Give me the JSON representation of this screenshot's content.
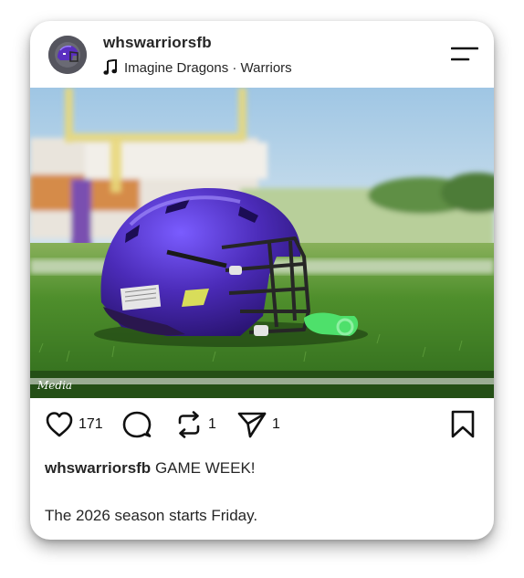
{
  "post": {
    "username": "whswarriorsfb",
    "avatar_icon": "helmet-avatar",
    "music": {
      "icon": "music-note-icon",
      "text": "Imagine Dragons · Warriors"
    },
    "menu_icon": "menu-icon",
    "image_description_icon": "football-helmet-photo",
    "watermark": "Media",
    "likes": "171",
    "reposts": "1",
    "shares": "1",
    "caption_user": "whswarriorsfb",
    "caption_text": "GAME WEEK!",
    "caption_line2": "The 2026 season starts Friday."
  },
  "colors": {
    "helmet": "#4a2bb0",
    "grass": "#3f8a2a",
    "goalpost": "#e6d46a",
    "sky": "#b9d6ea",
    "mouthguard": "#3cd46a"
  }
}
